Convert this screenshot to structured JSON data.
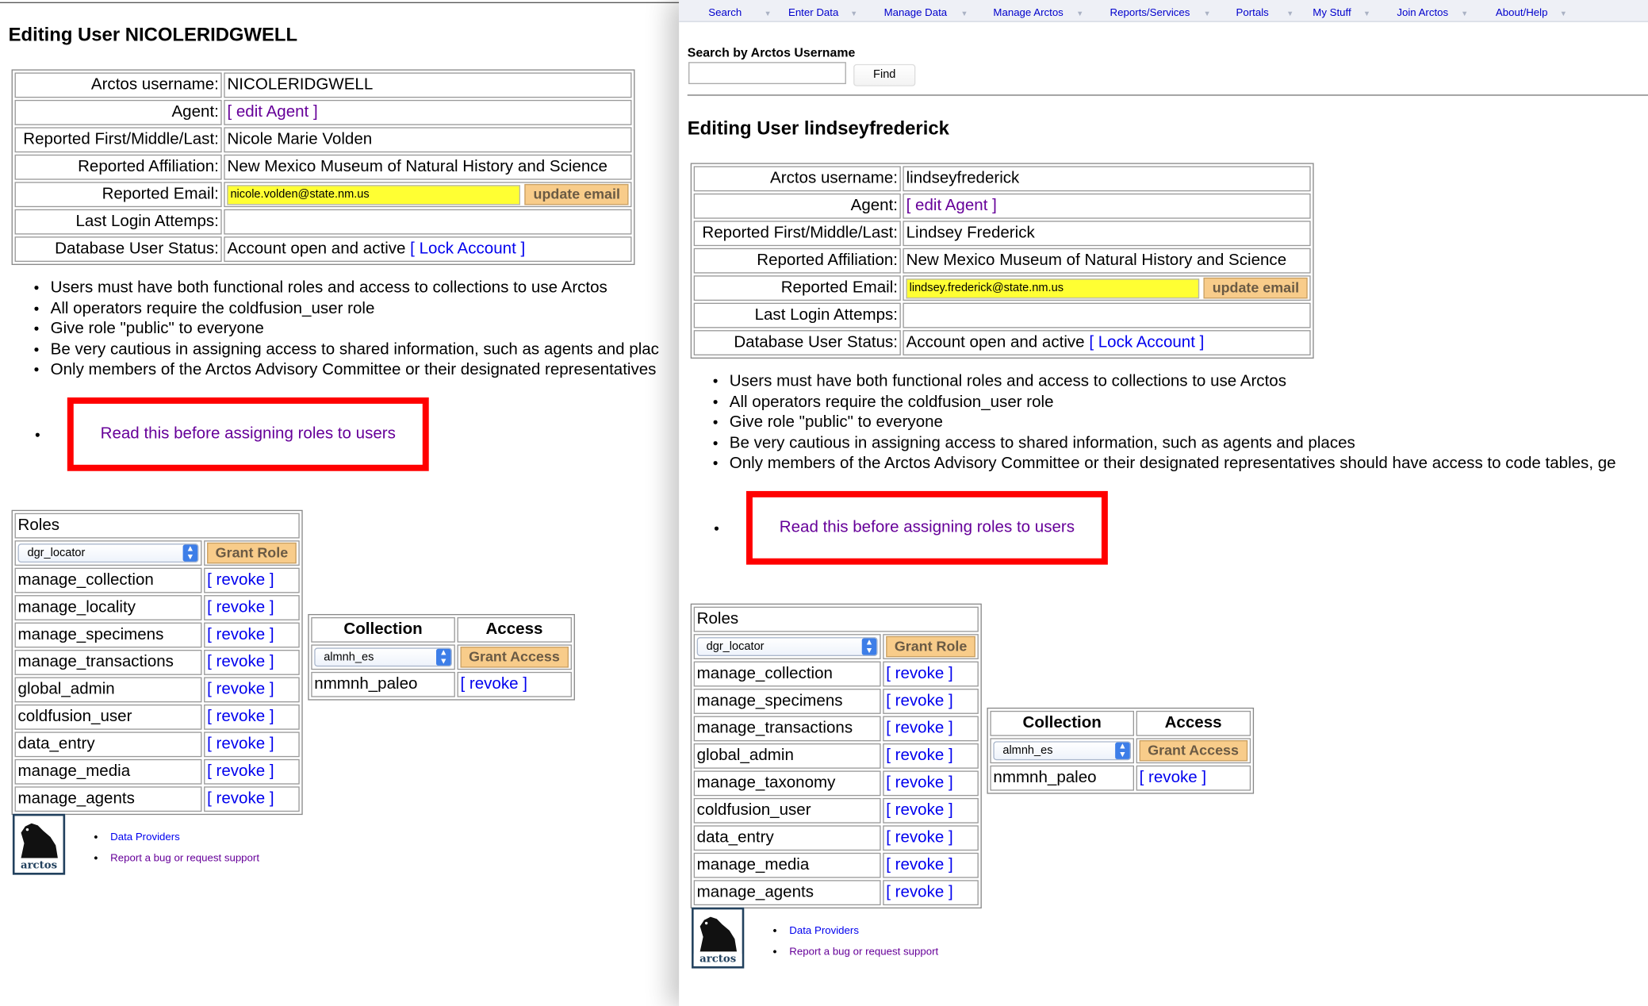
{
  "left": {
    "title": "Editing User NICOLERIDGWELL",
    "info": {
      "username_label": "Arctos username:",
      "username": "NICOLERIDGWELL",
      "agent_label": "Agent:",
      "agent_link": "[ edit Agent ]",
      "name_label": "Reported First/Middle/Last:",
      "name": "Nicole Marie Volden",
      "affiliation_label": "Reported Affiliation:",
      "affiliation": "New Mexico Museum of Natural History and Science",
      "email_label": "Reported Email:",
      "email": "nicole.volden@state.nm.us",
      "update_email": "update email",
      "login_label": "Last Login Attemps:",
      "login": "",
      "status_label": "Database User Status:",
      "status": "Account open and active",
      "lock": "[ Lock Account ]"
    },
    "notes": [
      "Users must have both functional roles and access to collections to use Arctos",
      "All operators require the coldfusion_user role",
      "Give role \"public\" to everyone",
      "Be very cautious in assigning access to shared information, such as agents and plac",
      "Only members of the Arctos Advisory Committee or their designated representatives"
    ],
    "read_link": "Read this before assigning roles to users",
    "roles_header": "Roles",
    "role_select": "dgr_locator",
    "grant_role": "Grant Role",
    "revoke": "[ revoke ]",
    "roles": [
      "manage_collection",
      "manage_locality",
      "manage_specimens",
      "manage_transactions",
      "global_admin",
      "coldfusion_user",
      "data_entry",
      "manage_media",
      "manage_agents"
    ],
    "coll_header": "Collection",
    "access_header": "Access",
    "coll_select": "almnh_es",
    "grant_access": "Grant Access",
    "collections": [
      "nmmnh_paleo"
    ],
    "footer": [
      "Data Providers",
      "Report a bug or request support"
    ],
    "logo_text": "arctos"
  },
  "right": {
    "nav": [
      "Search",
      "Enter Data",
      "Manage Data",
      "Manage Arctos",
      "Reports/Services",
      "Portals",
      "My Stuff",
      "Join Arctos",
      "About/Help"
    ],
    "search_label": "Search by Arctos Username",
    "find": "Find",
    "title": "Editing User lindseyfrederick",
    "info": {
      "username_label": "Arctos username:",
      "username": "lindseyfrederick",
      "agent_label": "Agent:",
      "agent_link": "[ edit Agent ]",
      "name_label": "Reported First/Middle/Last:",
      "name": "Lindsey Frederick",
      "affiliation_label": "Reported Affiliation:",
      "affiliation": "New Mexico Museum of Natural History and Science",
      "email_label": "Reported Email:",
      "email": "lindsey.frederick@state.nm.us",
      "update_email": "update email",
      "login_label": "Last Login Attemps:",
      "login": "",
      "status_label": "Database User Status:",
      "status": "Account open and active",
      "lock": "[ Lock Account ]"
    },
    "notes": [
      "Users must have both functional roles and access to collections to use Arctos",
      "All operators require the coldfusion_user role",
      "Give role \"public\" to everyone",
      "Be very cautious in assigning access to shared information, such as agents and places",
      "Only members of the Arctos Advisory Committee or their designated representatives should have access to code tables, ge"
    ],
    "read_link": "Read this before assigning roles to users",
    "roles_header": "Roles",
    "role_select": "dgr_locator",
    "grant_role": "Grant Role",
    "revoke": "[ revoke ]",
    "roles": [
      "manage_collection",
      "manage_specimens",
      "manage_transactions",
      "global_admin",
      "manage_taxonomy",
      "coldfusion_user",
      "data_entry",
      "manage_media",
      "manage_agents"
    ],
    "coll_header": "Collection",
    "access_header": "Access",
    "coll_select": "almnh_es",
    "grant_access": "Grant Access",
    "collections": [
      "nmmnh_paleo"
    ],
    "footer": [
      "Data Providers",
      "Report a bug or request support"
    ],
    "logo_text": "arctos"
  }
}
